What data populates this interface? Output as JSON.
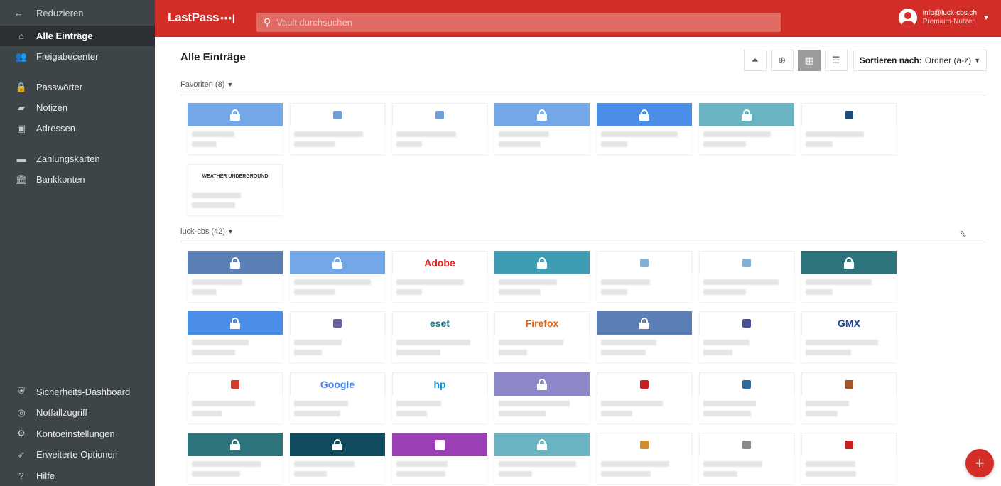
{
  "sidebar": {
    "collapse": "Reduzieren",
    "items": [
      {
        "label": "Alle Einträge",
        "icon": "home-icon",
        "active": true
      },
      {
        "label": "Freigabecenter",
        "icon": "sharing-icon"
      },
      {
        "label": "Passwörter",
        "icon": "lock-icon"
      },
      {
        "label": "Notizen",
        "icon": "note-icon"
      },
      {
        "label": "Adressen",
        "icon": "address-icon"
      },
      {
        "label": "Zahlungskarten",
        "icon": "card-icon"
      },
      {
        "label": "Bankkonten",
        "icon": "bank-icon"
      }
    ],
    "bottom": [
      {
        "label": "Sicherheits-Dashboard",
        "icon": "shield-icon"
      },
      {
        "label": "Notfallzugriff",
        "icon": "lifebuoy-icon"
      },
      {
        "label": "Kontoeinstellungen",
        "icon": "gear-icon"
      },
      {
        "label": "Erweiterte Optionen",
        "icon": "rocket-icon"
      },
      {
        "label": "Hilfe",
        "icon": "help-icon"
      }
    ]
  },
  "topbar": {
    "logo": "LastPass",
    "logo_dots": "•••|",
    "search_placeholder": "Vault durchsuchen",
    "email": "info@luck-cbs.ch",
    "role": "Premium-Nutzer",
    "accent": "#d32d27"
  },
  "main": {
    "title": "Alle Einträge",
    "sort_label": "Sortieren nach:",
    "sort_value": "Ordner (a-z)",
    "folders": [
      {
        "name": "Favoriten (8)",
        "tiles": [
          {
            "type": "lock",
            "color": "#72a8e8"
          },
          {
            "type": "favicon",
            "color": "#6fa0d8"
          },
          {
            "type": "favicon",
            "color": "#6fa0d8"
          },
          {
            "type": "lock",
            "color": "#72a8e8"
          },
          {
            "type": "lock",
            "color": "#4a8ee8"
          },
          {
            "type": "lock",
            "color": "#6ab3c2"
          },
          {
            "type": "favicon",
            "color": "#1f4b7a"
          },
          {
            "type": "brand",
            "brand": "WEATHER UNDERGROUND",
            "color": "#e33a2a"
          }
        ]
      },
      {
        "name": "luck-cbs (42)",
        "tiles": [
          {
            "type": "lock",
            "color": "#5b7fb5"
          },
          {
            "type": "lock",
            "color": "#72a8e8"
          },
          {
            "type": "brand",
            "brand": "Adobe",
            "color": "#e8261c"
          },
          {
            "type": "lock",
            "color": "#3f9db3"
          },
          {
            "type": "favicon",
            "color": "#7fb0d8"
          },
          {
            "type": "favicon",
            "color": "#7fb0d8"
          },
          {
            "type": "lock",
            "color": "#2f747d"
          },
          {
            "type": "lock",
            "color": "#4a8ee8"
          },
          {
            "type": "favicon",
            "color": "#6a5fa0"
          },
          {
            "type": "brand",
            "brand": "eset",
            "color": "#1f7a8c"
          },
          {
            "type": "brand",
            "brand": "Firefox",
            "color": "#e66000"
          },
          {
            "type": "lock",
            "color": "#5b7fb5"
          },
          {
            "type": "favicon",
            "color": "#4b4f9a"
          },
          {
            "type": "brand",
            "brand": "GMX",
            "color": "#1c449b"
          },
          {
            "type": "favicon",
            "color": "#d23a2c"
          },
          {
            "type": "brand",
            "brand": "Google",
            "color": "#4285f4"
          },
          {
            "type": "brand",
            "brand": "hp",
            "color": "#0096d6"
          },
          {
            "type": "lock",
            "color": "#8b87c8"
          },
          {
            "type": "favicon",
            "color": "#c8201e"
          },
          {
            "type": "favicon",
            "color": "#2c6aa0"
          },
          {
            "type": "favicon",
            "color": "#a0582c"
          },
          {
            "type": "lock",
            "color": "#2f747d"
          },
          {
            "type": "lock",
            "color": "#0f4a5e"
          },
          {
            "type": "note",
            "color": "#9b3fb5"
          },
          {
            "type": "lock",
            "color": "#6ab3c2"
          },
          {
            "type": "favicon",
            "color": "#d2902c"
          },
          {
            "type": "favicon",
            "color": "#8a8a8a"
          },
          {
            "type": "favicon",
            "color": "#c8201e"
          }
        ]
      }
    ],
    "add_label": "+"
  }
}
